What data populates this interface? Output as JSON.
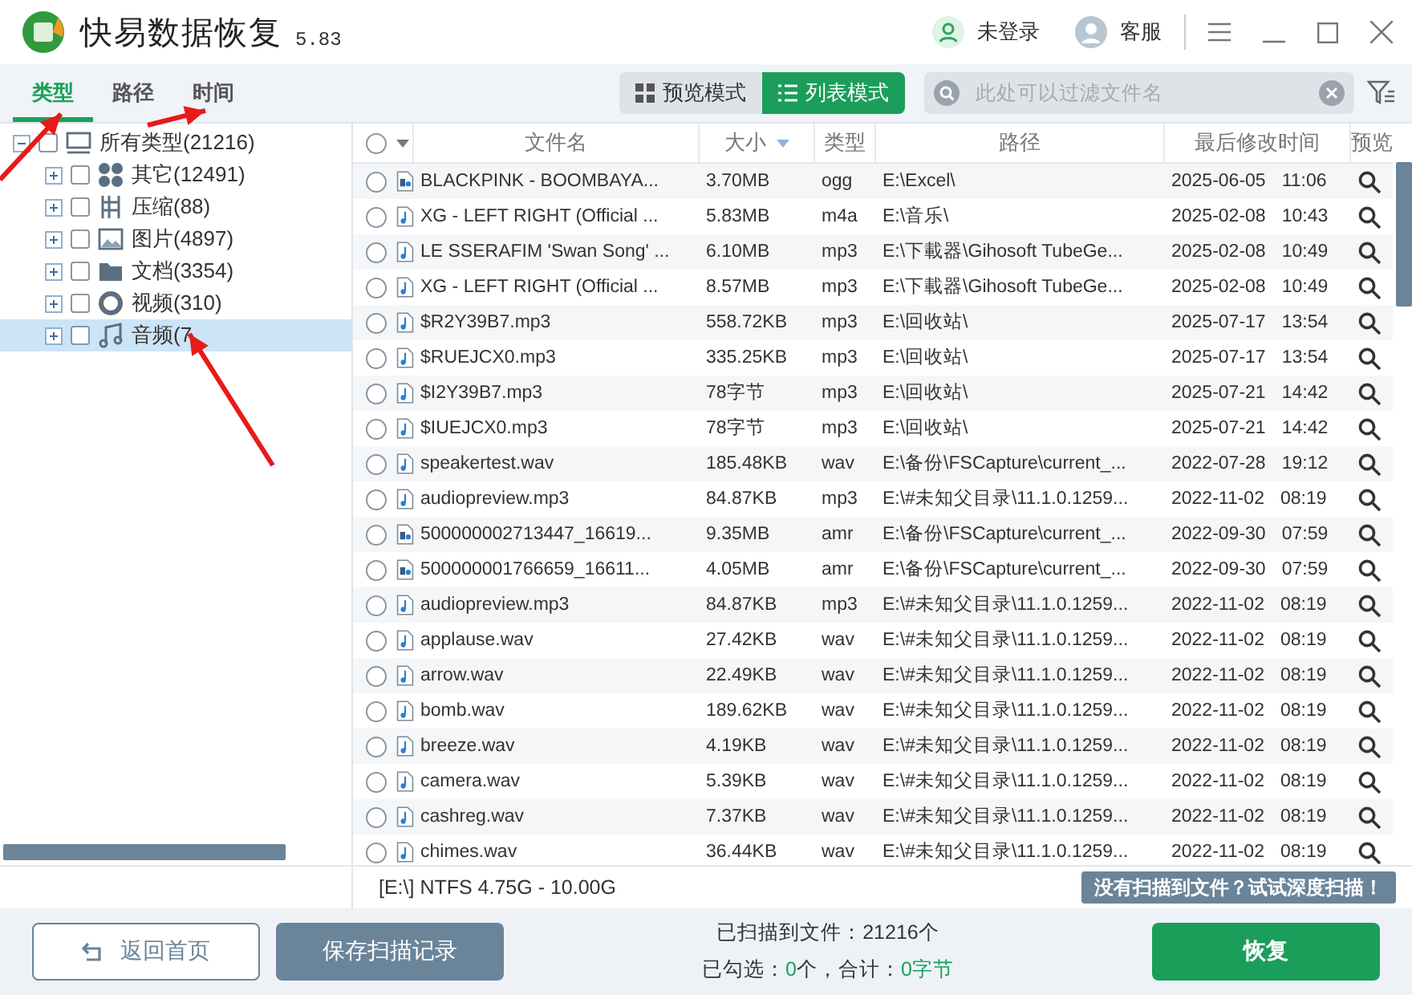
{
  "window": {
    "title": "快易数据恢复",
    "version": "5.83",
    "user": "未登录",
    "support": "客服"
  },
  "tabs": [
    {
      "label": "类型",
      "selected": true
    },
    {
      "label": "路径",
      "selected": false
    },
    {
      "label": "时间",
      "selected": false
    }
  ],
  "view_modes": [
    {
      "label": "预览模式",
      "kind": "grid",
      "selected": false
    },
    {
      "label": "列表模式",
      "kind": "list",
      "selected": true
    }
  ],
  "search": {
    "placeholder": "此处可以过滤文件名"
  },
  "tree": {
    "label": "所有类型(21216)",
    "expanded": true,
    "checked": false,
    "children": [
      {
        "label": "其它(12491)",
        "kind": "other",
        "checked": false,
        "expanded": false,
        "selected": false
      },
      {
        "label": "压缩(88)",
        "kind": "archive",
        "checked": false,
        "expanded": false,
        "selected": false
      },
      {
        "label": "图片(4897)",
        "kind": "image",
        "checked": false,
        "expanded": false,
        "selected": false
      },
      {
        "label": "文档(3354)",
        "kind": "folder",
        "checked": false,
        "expanded": false,
        "selected": false
      },
      {
        "label": "视频(310)",
        "kind": "video",
        "checked": false,
        "expanded": false,
        "selected": false
      },
      {
        "label": "音频(7",
        "kind": "audio",
        "checked": false,
        "expanded": false,
        "selected": true
      }
    ]
  },
  "table": {
    "select_all": {
      "checked": false
    },
    "columns": [
      "文件名",
      "大小",
      "类型",
      "路径",
      "最后修改时间",
      "预览"
    ],
    "rows": [
      {
        "kind": "media",
        "checked": false,
        "name": "BLACKPINK - BOOMBAYA...",
        "size": "3.70MB",
        "type": "ogg",
        "path": "E:\\Excel\\",
        "date": "2025-06-05",
        "time": "11:06"
      },
      {
        "kind": "note",
        "checked": false,
        "name": "XG - LEFT RIGHT (Official ...",
        "size": "5.83MB",
        "type": "m4a",
        "path": "E:\\音乐\\",
        "date": "2025-02-08",
        "time": "10:43"
      },
      {
        "kind": "note",
        "checked": false,
        "name": "LE SSERAFIM 'Swan Song' ...",
        "size": "6.10MB",
        "type": "mp3",
        "path": "E:\\下載器\\Gihosoft TubeGe...",
        "date": "2025-02-08",
        "time": "10:49"
      },
      {
        "kind": "note",
        "checked": false,
        "name": "XG - LEFT RIGHT (Official ...",
        "size": "8.57MB",
        "type": "mp3",
        "path": "E:\\下載器\\Gihosoft TubeGe...",
        "date": "2025-02-08",
        "time": "10:49"
      },
      {
        "kind": "note",
        "checked": false,
        "name": "$R2Y39B7.mp3",
        "size": "558.72KB",
        "type": "mp3",
        "path": "E:\\回收站\\",
        "date": "2025-07-17",
        "time": "13:54"
      },
      {
        "kind": "note",
        "checked": false,
        "name": "$RUEJCX0.mp3",
        "size": "335.25KB",
        "type": "mp3",
        "path": "E:\\回收站\\",
        "date": "2025-07-17",
        "time": "13:54"
      },
      {
        "kind": "note",
        "checked": false,
        "name": "$I2Y39B7.mp3",
        "size": "78字节",
        "type": "mp3",
        "path": "E:\\回收站\\",
        "date": "2025-07-21",
        "time": "14:42"
      },
      {
        "kind": "note",
        "checked": false,
        "name": "$IUEJCX0.mp3",
        "size": "78字节",
        "type": "mp3",
        "path": "E:\\回收站\\",
        "date": "2025-07-21",
        "time": "14:42"
      },
      {
        "kind": "note",
        "checked": false,
        "name": "speakertest.wav",
        "size": "185.48KB",
        "type": "wav",
        "path": "E:\\备份\\FSCapture\\current_...",
        "date": "2022-07-28",
        "time": "19:12"
      },
      {
        "kind": "note",
        "checked": false,
        "name": "audiopreview.mp3",
        "size": "84.87KB",
        "type": "mp3",
        "path": "E:\\#未知父目录\\11.1.0.1259...",
        "date": "2022-11-02",
        "time": "08:19"
      },
      {
        "kind": "media",
        "checked": false,
        "name": "500000002713447_16619...",
        "size": "9.35MB",
        "type": "amr",
        "path": "E:\\备份\\FSCapture\\current_...",
        "date": "2022-09-30",
        "time": "07:59"
      },
      {
        "kind": "media",
        "checked": false,
        "name": "500000001766659_16611...",
        "size": "4.05MB",
        "type": "amr",
        "path": "E:\\备份\\FSCapture\\current_...",
        "date": "2022-09-30",
        "time": "07:59"
      },
      {
        "kind": "note",
        "checked": false,
        "name": "audiopreview.mp3",
        "size": "84.87KB",
        "type": "mp3",
        "path": "E:\\#未知父目录\\11.1.0.1259...",
        "date": "2022-11-02",
        "time": "08:19"
      },
      {
        "kind": "note",
        "checked": false,
        "name": "applause.wav",
        "size": "27.42KB",
        "type": "wav",
        "path": "E:\\#未知父目录\\11.1.0.1259...",
        "date": "2022-11-02",
        "time": "08:19"
      },
      {
        "kind": "note",
        "checked": false,
        "name": "arrow.wav",
        "size": "22.49KB",
        "type": "wav",
        "path": "E:\\#未知父目录\\11.1.0.1259...",
        "date": "2022-11-02",
        "time": "08:19"
      },
      {
        "kind": "note",
        "checked": false,
        "name": "bomb.wav",
        "size": "189.62KB",
        "type": "wav",
        "path": "E:\\#未知父目录\\11.1.0.1259...",
        "date": "2022-11-02",
        "time": "08:19"
      },
      {
        "kind": "note",
        "checked": false,
        "name": "breeze.wav",
        "size": "4.19KB",
        "type": "wav",
        "path": "E:\\#未知父目录\\11.1.0.1259...",
        "date": "2022-11-02",
        "time": "08:19"
      },
      {
        "kind": "note",
        "checked": false,
        "name": "camera.wav",
        "size": "5.39KB",
        "type": "wav",
        "path": "E:\\#未知父目录\\11.1.0.1259...",
        "date": "2022-11-02",
        "time": "08:19"
      },
      {
        "kind": "note",
        "checked": false,
        "name": "cashreg.wav",
        "size": "7.37KB",
        "type": "wav",
        "path": "E:\\#未知父目录\\11.1.0.1259...",
        "date": "2022-11-02",
        "time": "08:19"
      },
      {
        "kind": "note",
        "checked": false,
        "name": "chimes.wav",
        "size": "36.44KB",
        "type": "wav",
        "path": "E:\\#未知父目录\\11.1.0.1259...",
        "date": "2022-11-02",
        "time": "08:19"
      }
    ]
  },
  "status_bar": {
    "drive": "[E:\\] NTFS 4.75G - 10.00G",
    "deep_scan": "没有扫描到文件？试试深度扫描！"
  },
  "footer": {
    "back": "返回首页",
    "save": "保存扫描记录",
    "scanned": "已扫描到文件：21216个",
    "selected_label": "已勾选：",
    "selected_count": "0",
    "total_label": "个，合计：",
    "total_size": "0字节",
    "recover": "恢复"
  }
}
